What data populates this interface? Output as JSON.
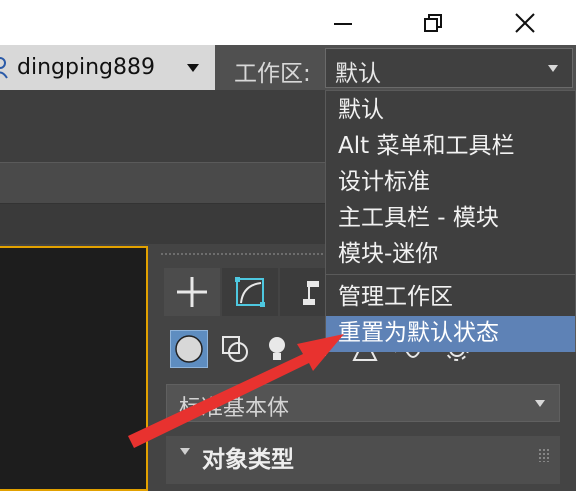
{
  "window_controls": {
    "icons": [
      "minimize-icon",
      "restore-icon",
      "close-icon"
    ]
  },
  "user": {
    "icon": "user-icon",
    "name": "dingping889"
  },
  "workspace": {
    "label": "工作区:",
    "selected": "默认",
    "options": [
      "默认",
      "Alt 菜单和工具栏",
      "设计标准",
      "主工具栏 - 模块",
      "模块-迷你",
      "管理工作区",
      "重置为默认状态"
    ],
    "highlighted_index": 6
  },
  "command_panel": {
    "tabs": [
      "create-tab-icon",
      "modify-tab-icon",
      "hierarchy-tab-icon"
    ],
    "categories": [
      "geometry-icon",
      "shapes-icon",
      "lights-icon",
      "cameras-icon",
      "helpers-icon",
      "spacewarps-icon",
      "systems-icon"
    ],
    "object_category_dropdown": "标准基本体",
    "rollout_title": "对象类型"
  },
  "colors": {
    "accent_highlight": "#5e82b6",
    "viewport_border": "#e2a100",
    "annotation_arrow": "#e8322f"
  }
}
